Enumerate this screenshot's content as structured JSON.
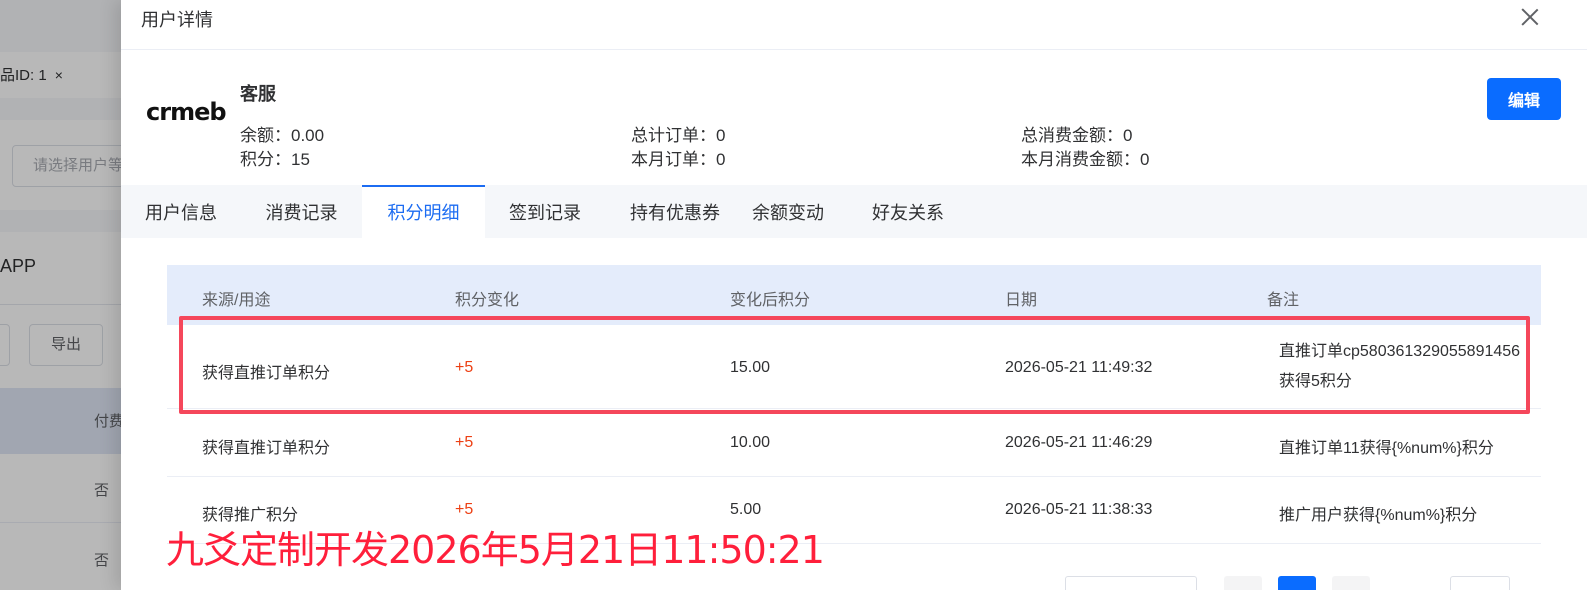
{
  "background": {
    "tag_label": "品ID: 1",
    "tag_close": "×",
    "select_placeholder": "请选择用户等",
    "section_label": "APP",
    "button_partial": "",
    "export_button": "导出",
    "table_header": "付费",
    "cell_values": [
      "否",
      "否"
    ]
  },
  "drawer": {
    "title": "用户详情",
    "close_label": "×"
  },
  "profile": {
    "logo_text": "crmeb",
    "name": "客服",
    "balance": "余额：0.00",
    "points": "积分：15",
    "total_orders": "总计订单：0",
    "month_orders": "本月订单：0",
    "total_spent": "总消费金额：0",
    "month_spent": "本月消费金额：0",
    "edit_label": "编辑"
  },
  "tabs": [
    {
      "label": "用户信息"
    },
    {
      "label": "消费记录"
    },
    {
      "label": "积分明细",
      "active": true
    },
    {
      "label": "签到记录"
    },
    {
      "label": "持有优惠券"
    },
    {
      "label": "余额变动"
    },
    {
      "label": "好友关系"
    }
  ],
  "table": {
    "columns": [
      "来源/用途",
      "积分变化",
      "变化后积分",
      "日期",
      "备注"
    ],
    "rows": [
      {
        "source": "获得直推订单积分",
        "change": "+5",
        "after": "15.00",
        "date": "2026-05-21 11:49:32",
        "note_line1": "直推订单cp580361329055891456",
        "note_line2": "获得5积分"
      },
      {
        "source": "获得直推订单积分",
        "change": "+5",
        "after": "10.00",
        "date": "2026-05-21 11:46:29",
        "note_line1": "直推订单11获得{%num%}积分",
        "note_line2": ""
      },
      {
        "source": "获得推广积分",
        "change": "+5",
        "after": "5.00",
        "date": "2026-05-21 11:38:33",
        "note_line1": "推广用户获得{%num%}积分",
        "note_line2": ""
      }
    ]
  },
  "watermark": "九爻定制开发2026年5月21日11:50:21",
  "colors": {
    "primary": "#0a6cff",
    "active_tab": "#1c6cf2",
    "points_change": "#ed4014",
    "highlight_border": "#f5475b",
    "watermark": "#ff1f3b"
  }
}
